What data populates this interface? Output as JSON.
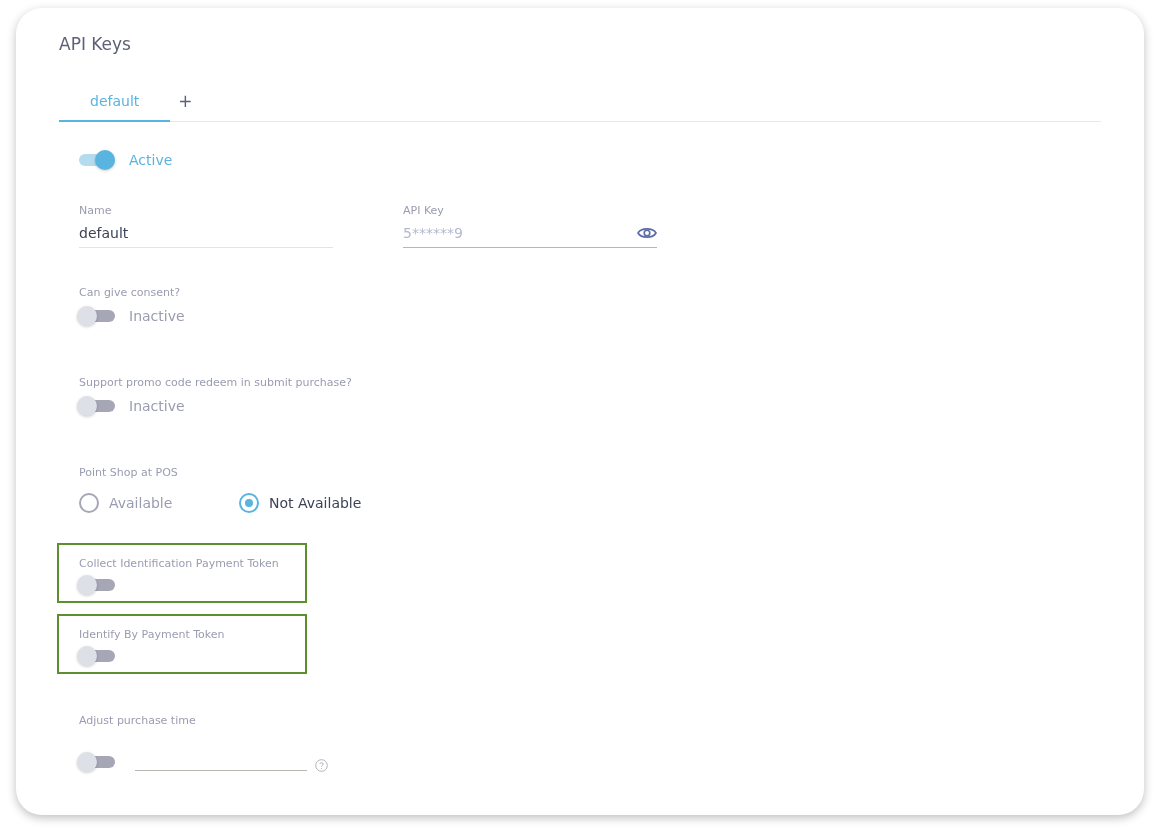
{
  "title": "API Keys",
  "tabs": [
    {
      "kind": "tab",
      "label": "default",
      "selected": true
    },
    {
      "kind": "add",
      "label": "+",
      "selected": false
    }
  ],
  "status": {
    "on": true,
    "label": "Active"
  },
  "fields": [
    {
      "label": "Name",
      "value": "default",
      "masked": false
    },
    {
      "label": "API Key",
      "value": "5******9",
      "masked": true
    }
  ],
  "settings": [
    {
      "kind": "toggle",
      "label": "Can give consent?",
      "on": false,
      "state_text": "Inactive",
      "highlighted": false
    },
    {
      "kind": "toggle",
      "label": "Support promo code redeem in submit purchase?",
      "on": false,
      "state_text": "Inactive",
      "highlighted": false
    },
    {
      "kind": "radio",
      "label": "Point Shop at POS",
      "options": [
        {
          "label": "Available",
          "selected": false
        },
        {
          "label": "Not Available",
          "selected": true
        }
      ]
    },
    {
      "kind": "toggle",
      "label": "Collect Identification Payment Token",
      "on": false,
      "highlighted": true
    },
    {
      "kind": "toggle",
      "label": "Identify By Payment Token",
      "on": false,
      "highlighted": true
    },
    {
      "kind": "toggle_input",
      "label": "Adjust purchase time",
      "on": false,
      "highlighted": false
    }
  ]
}
